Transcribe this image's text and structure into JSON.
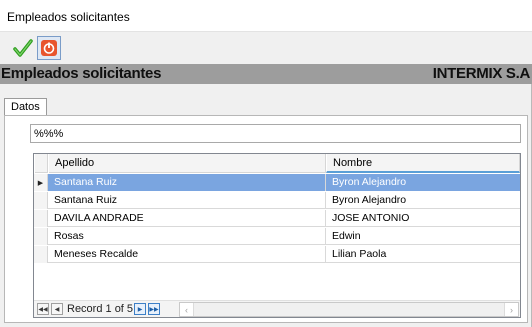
{
  "window": {
    "title": "Empleados solicitantes"
  },
  "toolbar": {
    "accept_icon": "green-checkmark-icon",
    "exit_icon": "power-button-icon",
    "colors": {
      "accept": "#2e9e1f",
      "exit": "#e8552d"
    }
  },
  "header": {
    "left": "Empleados solicitantes",
    "right": "INTERMIX S.A"
  },
  "tabs": [
    {
      "label": "Datos"
    }
  ],
  "search": {
    "value": "%%%"
  },
  "grid": {
    "columns": [
      "Apellido",
      "Nombre"
    ],
    "rows": [
      {
        "apellido": "Santana Ruiz",
        "nombre": "Byron Alejandro",
        "selected": true
      },
      {
        "apellido": "Santana Ruiz",
        "nombre": "Byron Alejandro",
        "selected": false
      },
      {
        "apellido": "DAVILA ANDRADE",
        "nombre": "JOSE ANTONIO",
        "selected": false
      },
      {
        "apellido": "Rosas",
        "nombre": "Edwin",
        "selected": false
      },
      {
        "apellido": "Meneses Recalde",
        "nombre": "Lilian Paola",
        "selected": false
      }
    ],
    "selection_color": "#7aa5e0"
  },
  "navigator": {
    "record_text": "Record 1 of 5"
  }
}
